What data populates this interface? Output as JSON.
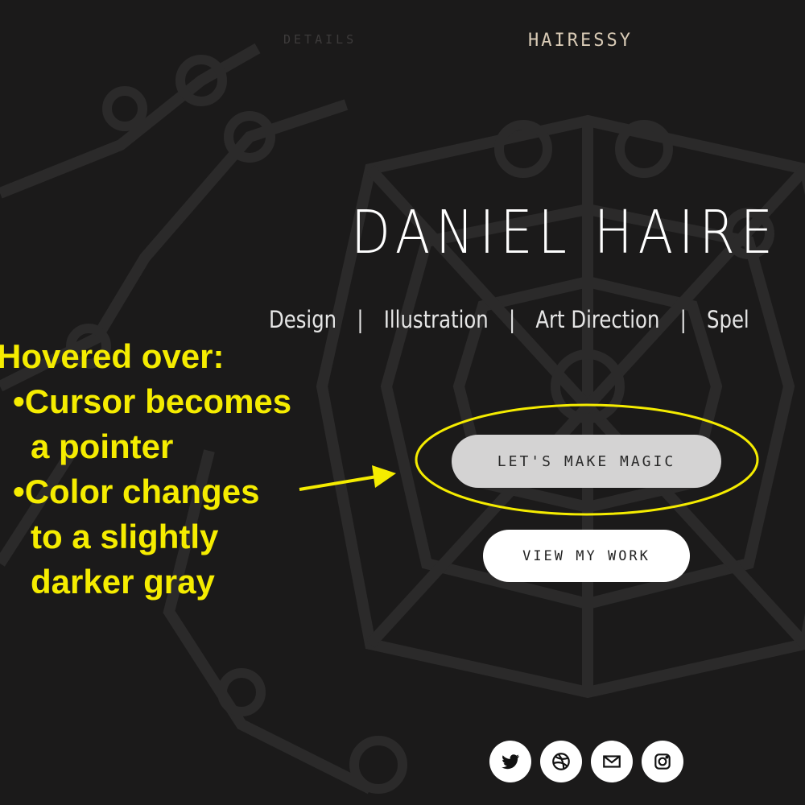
{
  "nav": {
    "details": "DETAILS",
    "brand": "HAIRESSY"
  },
  "hero": {
    "title": "DANIEL HAIRE",
    "subtitle": [
      "Design",
      "Illustration",
      "Art Direction",
      "Spel"
    ],
    "separator": "|"
  },
  "buttons": {
    "primary": "LET'S MAKE MAGIC",
    "secondary": "VIEW MY WORK"
  },
  "annotation": {
    "heading": "Hovered over:",
    "lines": [
      "•Cursor becomes",
      "a pointer",
      "•Color changes",
      "to a slightly",
      "darker gray"
    ],
    "color": "#f5ec00"
  },
  "social": [
    "twitter-icon",
    "dribbble-icon",
    "mail-icon",
    "instagram-icon"
  ],
  "colors": {
    "background": "#1b1a1a",
    "brand": "#d9cbb6",
    "hover_gray": "#d4d3d3"
  }
}
